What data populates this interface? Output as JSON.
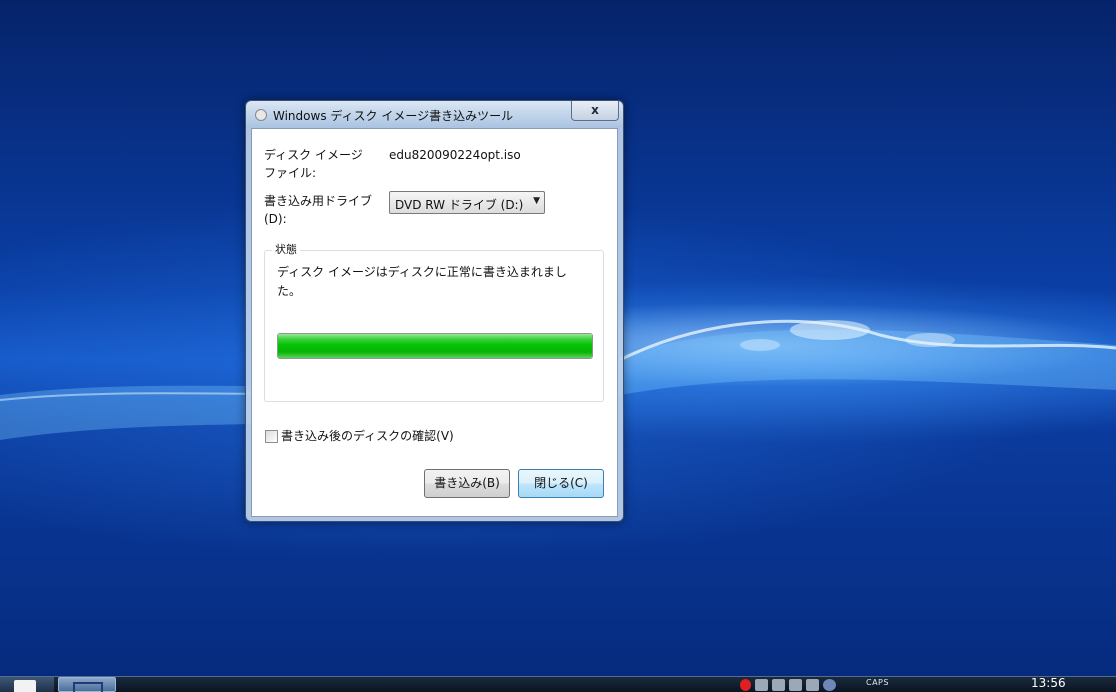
{
  "dialog": {
    "title": "Windows ディスク イメージ書き込みツール",
    "close_label": "x",
    "image_file_label_line1": "ディスク イメージ",
    "image_file_label_line2": "ファイル:",
    "image_file_value": "edu820090224opt.iso",
    "drive_label_line1": "書き込み用ドライブ",
    "drive_label_line2": "(D):",
    "drive_selected": "DVD RW ドライブ (D:)",
    "status_group_title": "状態",
    "status_message": "ディスク イメージはディスクに正常に書き込まれました。",
    "progress_percent": 100,
    "verify_checkbox_label": "書き込み後のディスクの確認(V)",
    "verify_checked": false,
    "burn_button": "書き込み(B)",
    "close_button": "閉じる(C)"
  },
  "taskbar": {
    "caps_indicator": "CAPS",
    "clock": "13:56"
  },
  "colors": {
    "progress_green": "#05c305",
    "desktop_blue": "#0a3fa6",
    "close_button_accent": "#3c7fb1"
  }
}
